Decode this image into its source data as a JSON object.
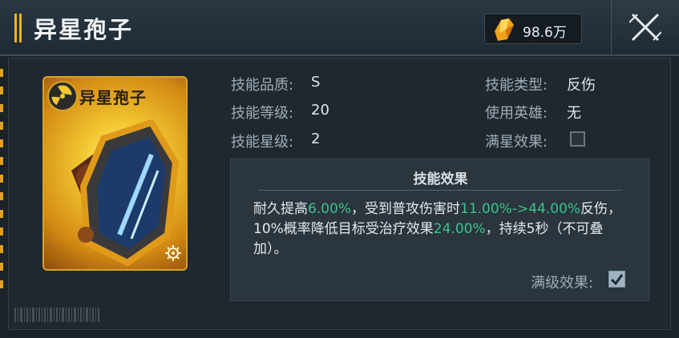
{
  "header": {
    "title": "异星孢子",
    "currency_value": "98.6万"
  },
  "card": {
    "title": "异星孢子"
  },
  "stats": {
    "quality_label": "技能品质:",
    "quality_value": "S",
    "level_label": "技能等级:",
    "level_value": "20",
    "star_label": "技能星级:",
    "star_value": "2",
    "type_label": "技能类型:",
    "type_value": "反伤",
    "hero_label": "使用英雄:",
    "hero_value": "无",
    "full_star_label": "满星效果:"
  },
  "effect": {
    "title": "技能效果",
    "parts": [
      {
        "text": "耐久提高",
        "highlight": false
      },
      {
        "text": "6.00%",
        "highlight": true
      },
      {
        "text": "，受到普攻伤害时",
        "highlight": false
      },
      {
        "text": "11.00%->44.00%",
        "highlight": true
      },
      {
        "text": "反伤，10%概率降低目标受治疗效果",
        "highlight": false
      },
      {
        "text": "24.00%",
        "highlight": true
      },
      {
        "text": "，持续5秒（不可叠加）。",
        "highlight": false
      }
    ],
    "max_level_label": "满级效果:"
  },
  "colors": {
    "highlight": "#3cc38a",
    "accent": "#f2b326"
  },
  "icons": {
    "currency": "crystal-icon",
    "close": "close-icon"
  }
}
